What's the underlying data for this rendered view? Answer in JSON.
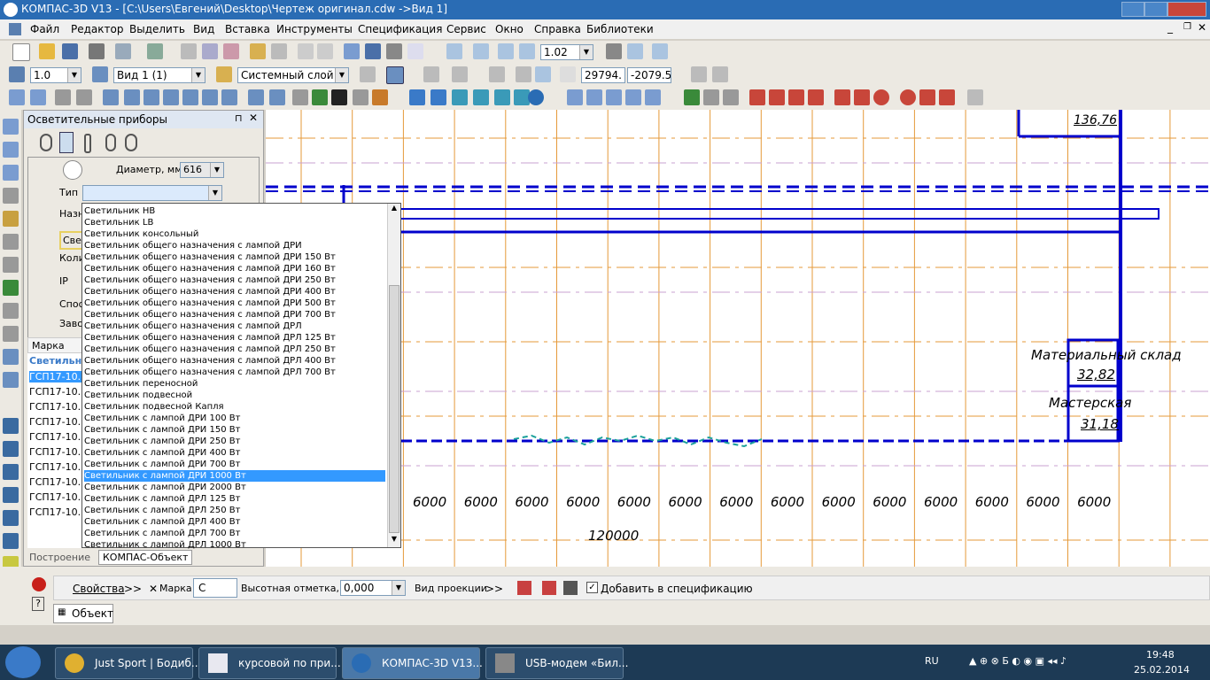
{
  "window": {
    "title": "КОМПАС-3D V13 - [C:\\Users\\Евгений\\Desktop\\Чертеж оригинал.cdw ->Вид 1]"
  },
  "menu": [
    "Файл",
    "Редактор",
    "Выделить",
    "Вид",
    "Вставка",
    "Инструменты",
    "Спецификация",
    "Сервис",
    "Окно",
    "Справка",
    "Библиотеки"
  ],
  "toolbar1": {
    "zoom_value": "1.02"
  },
  "toolbar2": {
    "scale_value": "1.0",
    "view_value": "Вид 1 (1)",
    "layer_value": "Системный слой (",
    "coord_x": "29794.",
    "coord_y": "-2079.5"
  },
  "panel": {
    "title": "Осветительные приборы",
    "diameter_label": "Диаметр, мм",
    "diameter_value": "616",
    "type_label": "Тип",
    "type_value": "",
    "partial_labels": [
      "Назн",
      "Свет",
      "Коли",
      "IP",
      "Спос",
      "Заво"
    ],
    "list_header": "Марка",
    "list_group": "Светильни",
    "list_rows": [
      "ГСП17-10...",
      "ГСП17-10...",
      "ГСП17-10...",
      "ГСП17-10...",
      "ГСП17-10...",
      "ГСП17-10...",
      "ГСП17-10...",
      "ГСП17-10...",
      "ГСП17-10...",
      "ГСП17-10..."
    ],
    "tabs": [
      "Построение",
      "КОМПАС-Объект"
    ]
  },
  "dropdown": {
    "items": [
      "Светильник НВ",
      "Светильник LB",
      "Светильник консольный",
      "Светильник общего назначения с лампой ДРИ",
      "Светильник общего назначения с лампой ДРИ 150 Вт",
      "Светильник общего назначения с лампой ДРИ 160 Вт",
      "Светильник общего назначения с лампой ДРИ 250 Вт",
      "Светильник общего назначения с лампой ДРИ 400 Вт",
      "Светильник общего назначения с лампой ДРИ 500 Вт",
      "Светильник общего назначения с лампой ДРИ 700 Вт",
      "Светильник общего назначения с лампой ДРЛ",
      "Светильник общего назначения с лампой ДРЛ 125 Вт",
      "Светильник общего назначения с лампой ДРЛ 250 Вт",
      "Светильник общего назначения с лампой ДРЛ 400 Вт",
      "Светильник общего назначения с лампой ДРЛ 700 Вт",
      "Светильник переносной",
      "Светильник подвесной",
      "Светильник подвесной Капля",
      "Светильник с лампой ДРИ 100 Вт",
      "Светильник с лампой ДРИ 150 Вт",
      "Светильник с лампой ДРИ 250 Вт",
      "Светильник с лампой ДРИ 400 Вт",
      "Светильник с лампой ДРИ 700 Вт",
      "Светильник с лампой ДРИ 1000 Вт",
      "Светильник с лампой ДРИ 2000 Вт",
      "Светильник с лампой ДРЛ 125 Вт",
      "Светильник с лампой ДРЛ 250 Вт",
      "Светильник с лампой ДРЛ 400 Вт",
      "Светильник с лампой ДРЛ 700 Вт",
      "Светильник с лампой ДРЛ 1000 Вт"
    ],
    "selected_index": 23
  },
  "drawing": {
    "area_top": "136,76",
    "room1_name": "Материальный склад",
    "room1_area": "32,82",
    "room2_name": "Мастерская",
    "room2_area": "31,18",
    "dims": [
      "6000",
      "6000",
      "6000",
      "6000",
      "6000",
      "6000",
      "6000",
      "6000",
      "6000",
      "6000",
      "6000",
      "6000",
      "6000",
      "6000"
    ],
    "total": "120000",
    "colors": {
      "grid": "#e59a3a",
      "wall": "#0000cc",
      "hatch": "#1aa09a"
    }
  },
  "properties": {
    "props_label": "Свойства",
    "mark_label": "Марка",
    "mark_value": "С",
    "height_label": "Высотная отметка, м",
    "height_value": "0,000",
    "projection_label": "Вид проекции",
    "add_spec_label": "Добавить в спецификацию",
    "object_tab": "Объект"
  },
  "taskbar": {
    "items": [
      "Just Sport | Бодиб...",
      "курсовой по при...",
      "КОМПАС-3D V13...",
      "USB-модем «Бил..."
    ],
    "lang": "RU",
    "time": "19:48",
    "date": "25.02.2014"
  }
}
